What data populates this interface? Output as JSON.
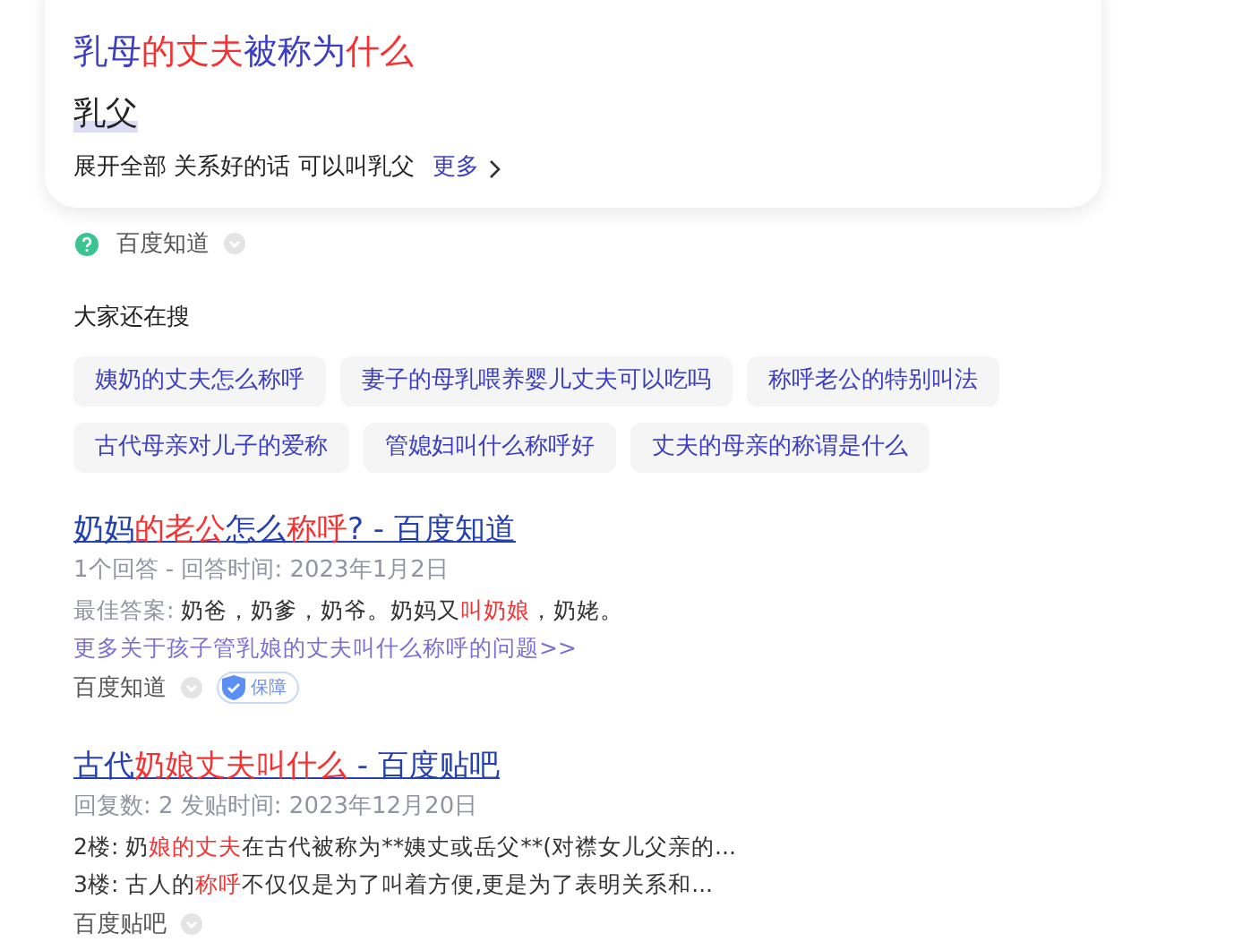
{
  "answer_card": {
    "title": [
      {
        "text": "乳母",
        "highlight": false
      },
      {
        "text": "的丈夫",
        "highlight": true
      },
      {
        "text": "被称为",
        "highlight": false
      },
      {
        "text": "什么",
        "highlight": true
      }
    ],
    "answer": "乳父",
    "summary": "展开全部 关系好的话 可以叫乳父",
    "more_link": "更多"
  },
  "card_source": {
    "name": "百度知道"
  },
  "related": {
    "heading": "大家还在搜",
    "chips": [
      "姨奶的丈夫怎么称呼",
      "妻子的母乳喂养婴儿丈夫可以吃吗",
      "称呼老公的特别叫法",
      "古代母亲对儿子的爱称",
      "管媳妇叫什么称呼好",
      "丈夫的母亲的称谓是什么"
    ]
  },
  "results": [
    {
      "title": [
        {
          "text": "奶妈",
          "highlight": false
        },
        {
          "text": "的老公",
          "highlight": true
        },
        {
          "text": "怎么",
          "highlight": false
        },
        {
          "text": "称呼",
          "highlight": true
        },
        {
          "text": "? - 百度知道",
          "highlight": false
        }
      ],
      "meta": "1个回答 - 回答时间: 2023年1月2日",
      "lines": [
        [
          {
            "text": "最佳答案: ",
            "highlight": false,
            "muted": true
          },
          {
            "text": "奶爸，奶爹，奶爷。奶妈又",
            "highlight": false,
            "muted": false
          },
          {
            "text": "叫奶娘",
            "highlight": true,
            "muted": false
          },
          {
            "text": "，奶姥。",
            "highlight": false,
            "muted": false
          }
        ]
      ],
      "more_link": "更多关于孩子管乳娘的丈夫叫什么称呼的问题>>",
      "source": "百度知道",
      "badge": "保障"
    },
    {
      "title": [
        {
          "text": "古代",
          "highlight": false
        },
        {
          "text": "奶娘丈夫叫什么",
          "highlight": true
        },
        {
          "text": " - 百度贴吧",
          "highlight": false
        }
      ],
      "meta": "回复数: 2 发贴时间: 2023年12月20日",
      "lines": [
        [
          {
            "text": "2楼: 奶",
            "highlight": false,
            "muted": false
          },
          {
            "text": "娘的丈夫",
            "highlight": true,
            "muted": false
          },
          {
            "text": "在古代被称为**姨丈或岳父**(对襟女儿父亲的...",
            "highlight": false,
            "muted": false
          }
        ],
        [
          {
            "text": "3楼: 古人的",
            "highlight": false,
            "muted": false
          },
          {
            "text": "称呼",
            "highlight": true,
            "muted": false
          },
          {
            "text": "不仅仅是为了叫着方便,更是为了表明关系和...",
            "highlight": false,
            "muted": false
          }
        ]
      ],
      "source": "百度贴吧"
    }
  ]
}
